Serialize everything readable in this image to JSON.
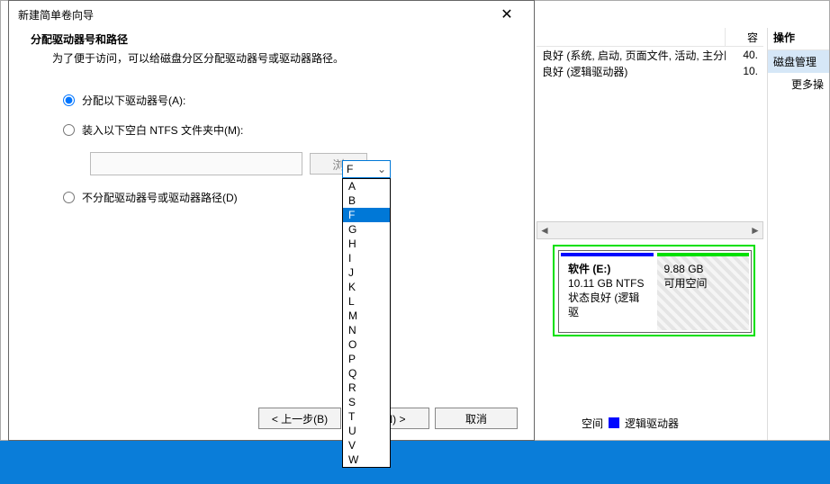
{
  "dialog": {
    "title": "新建简单卷向导",
    "heading": "分配驱动器号和路径",
    "subheading": "为了便于访问，可以给磁盘分区分配驱动器号或驱动器路径。",
    "option_assign": "分配以下驱动器号(A):",
    "option_mount": "装入以下空白 NTFS 文件夹中(M):",
    "option_none": "不分配驱动器号或驱动器路径(D)",
    "browse": "浏",
    "selected_letter": "F",
    "letters": [
      "A",
      "B",
      "F",
      "G",
      "H",
      "I",
      "J",
      "K",
      "L",
      "M",
      "N",
      "O",
      "P",
      "Q",
      "R",
      "S",
      "T",
      "U",
      "V",
      "W"
    ],
    "btn_back": "< 上一步(B)",
    "btn_next": "步(N) >",
    "btn_cancel": "取消"
  },
  "bg": {
    "col_status": "良好 (系统, 启动, 页面文件, 活动, 主分区)",
    "col_status2": "良好 (逻辑驱动器)",
    "cap_header": "容",
    "cap1": "40.",
    "cap2": "10.",
    "side_head": "操作",
    "side_item": "磁盘管理",
    "side_more": "更多操",
    "vol1_name": "软件  (E:)",
    "vol1_size": "10.11 GB NTFS",
    "vol1_status": "状态良好 (逻辑驱",
    "vol2_size": "9.88 GB",
    "vol2_status": "可用空间",
    "legend_space": "空间",
    "legend_logical": "逻辑驱动器"
  }
}
